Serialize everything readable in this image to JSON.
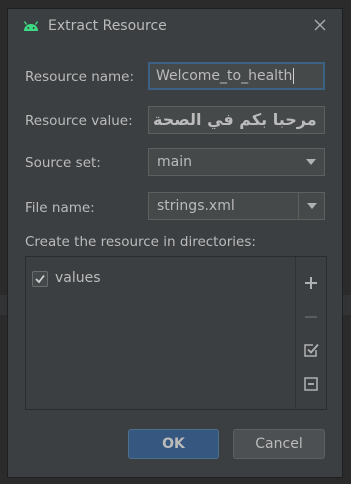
{
  "dialog": {
    "title": "Extract Resource",
    "close_icon": "close-icon"
  },
  "form": {
    "resource_name_label": "Resource name:",
    "resource_name_value": "Welcome_to_health",
    "resource_value_label": "Resource value:",
    "resource_value_value": "مرحبا بكم في الصحة",
    "source_set_label": "Source set:",
    "source_set_value": "main",
    "file_name_label": "File name:",
    "file_name_value": "strings.xml"
  },
  "directories": {
    "label": "Create the resource in directories:",
    "items": [
      {
        "label": "values",
        "checked": true
      }
    ],
    "toolbar": [
      "plus-icon",
      "minus-icon",
      "check-all-icon",
      "uncheck-all-icon"
    ]
  },
  "buttons": {
    "ok_label": "OK",
    "cancel_label": "Cancel"
  },
  "colors": {
    "dialog_bg": "#3c3f41",
    "field_bg": "#45494a",
    "focus_border": "#3d6185",
    "primary_button": "#365880",
    "android_green": "#3ddc84"
  }
}
